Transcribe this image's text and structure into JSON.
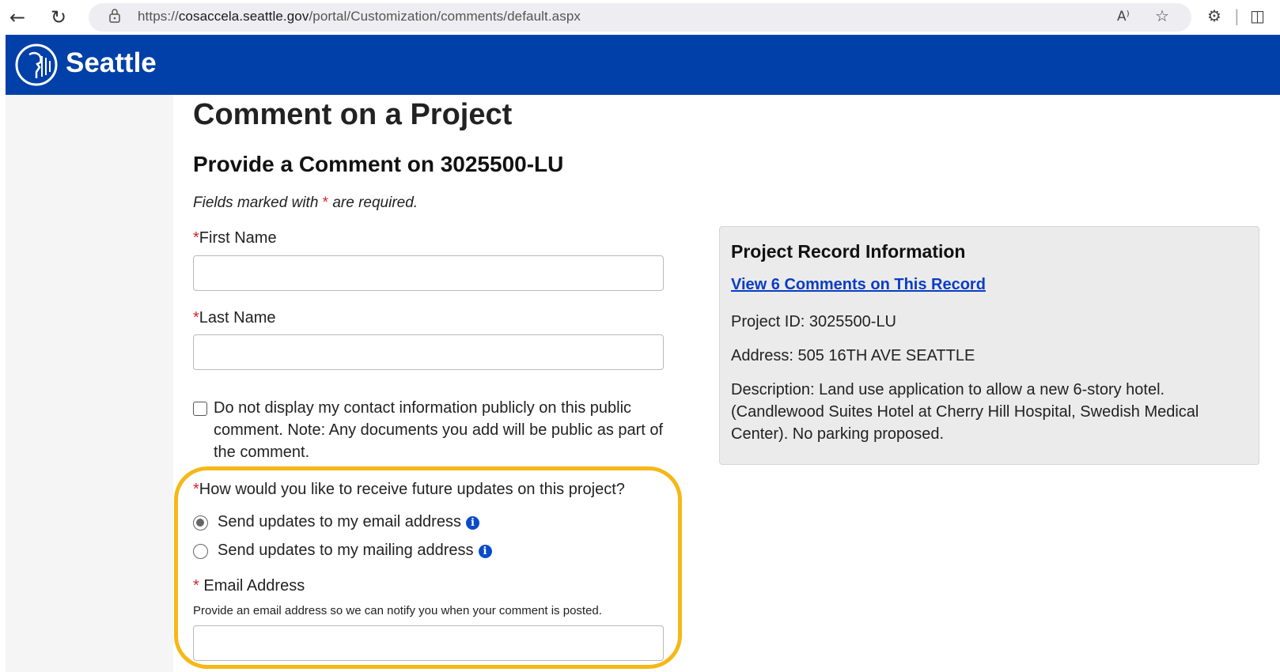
{
  "browser": {
    "url_prefix": "https://",
    "url_host": "cosaccela.seattle.gov",
    "url_path": "/portal/Customization/comments/default.aspx",
    "read_aloud_label": "A⁾"
  },
  "header": {
    "brand": "Seattle",
    "brand_color": "#0140a8"
  },
  "page": {
    "title": "Comment on a Project",
    "subtitle": "Provide a Comment on 3025500-LU",
    "required_note_before": "Fields marked with ",
    "required_note_star": "*",
    "required_note_after": " are required."
  },
  "form": {
    "first_name_label": "First Name",
    "first_name_value": "",
    "last_name_label": "Last Name",
    "last_name_value": "",
    "privacy_checkbox_label": "Do not display my contact information publicly on this public comment. Note: Any documents you add will be public as part of the comment.",
    "privacy_checked": false,
    "updates_question": "How would you like to receive future updates on this project?",
    "update_options": [
      {
        "label": "Send updates to my email address",
        "selected": true
      },
      {
        "label": "Send updates to my mailing address",
        "selected": false
      }
    ],
    "email_label": "Email Address",
    "email_help": "Provide an email address so we can notify you when your comment is posted.",
    "email_value": "",
    "required_star": "*",
    "highlight_color": "#f6b817"
  },
  "record_panel": {
    "title": "Project Record Information",
    "comments_link": "View 6 Comments on This Record",
    "project_id": "Project ID: 3025500-LU",
    "address": "Address: 505 16TH AVE SEATTLE",
    "description": "Description: Land use application to allow a new 6-story hotel. (Candlewood Suites Hotel at Cherry Hill Hospital, Swedish Medical Center). No parking proposed."
  }
}
